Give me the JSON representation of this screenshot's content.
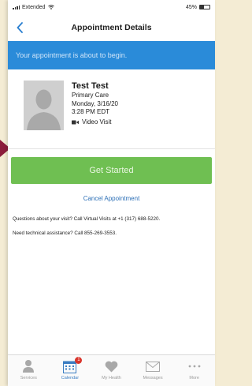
{
  "status_bar": {
    "carrier": "Extended",
    "battery": "45%"
  },
  "header": {
    "title": "Appointment Details"
  },
  "banner": {
    "text": "Your appointment is about to begin."
  },
  "appointment": {
    "patient_name": "Test Test",
    "department": "Primary Care",
    "date": "Monday, 3/16/20",
    "time": "3:28 PM EDT",
    "visit_type": "Video Visit"
  },
  "actions": {
    "get_started": "Get Started",
    "cancel": "Cancel Appointment"
  },
  "help": {
    "questions": "Questions about your visit? Call Virtual Visits at +1 (317) 688-5220.",
    "technical": "Need technical assistance? Call 855-269-3553."
  },
  "tabs": [
    {
      "label": "Services",
      "icon": "person-icon"
    },
    {
      "label": "Calendar",
      "icon": "calendar-icon",
      "badge": "1"
    },
    {
      "label": "My Health",
      "icon": "heart-icon"
    },
    {
      "label": "Messages",
      "icon": "envelope-icon"
    },
    {
      "label": "More",
      "icon": "more-dots-icon"
    }
  ],
  "colors": {
    "banner": "#2a8bd9",
    "primary_button": "#6fbf52",
    "link": "#2c6fb6",
    "badge": "#d9342b"
  }
}
